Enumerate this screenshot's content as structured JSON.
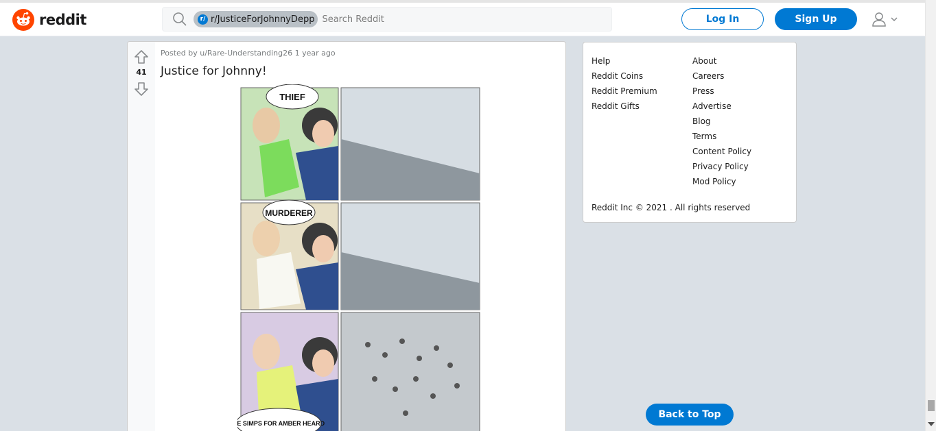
{
  "header": {
    "logo_text": "reddit",
    "search": {
      "community_prefix": "r/",
      "community": "r/JusticeForJohnnyDepp",
      "placeholder": "Search Reddit"
    },
    "login_label": "Log In",
    "signup_label": "Sign Up"
  },
  "post": {
    "vote_count": "41",
    "meta": "Posted by u/Rare-Understanding26 1 year ago",
    "title": "Justice for Johnny!",
    "image": {
      "panel_labels": [
        "THIEF",
        "MURDERER",
        "HE SIMPS FOR AMBER HEARD"
      ]
    }
  },
  "sidebar": {
    "left_links": [
      "Help",
      "Reddit Coins",
      "Reddit Premium",
      "Reddit Gifts"
    ],
    "right_links": [
      "About",
      "Careers",
      "Press",
      "Advertise",
      "Blog",
      "Terms",
      "Content Policy",
      "Privacy Policy",
      "Mod Policy"
    ],
    "copyright": "Reddit Inc © 2021 . All rights reserved"
  },
  "back_to_top_label": "Back to Top",
  "colors": {
    "brand_orange": "#ff4500",
    "accent_blue": "#0079d3",
    "page_bg": "#dae0e6"
  }
}
